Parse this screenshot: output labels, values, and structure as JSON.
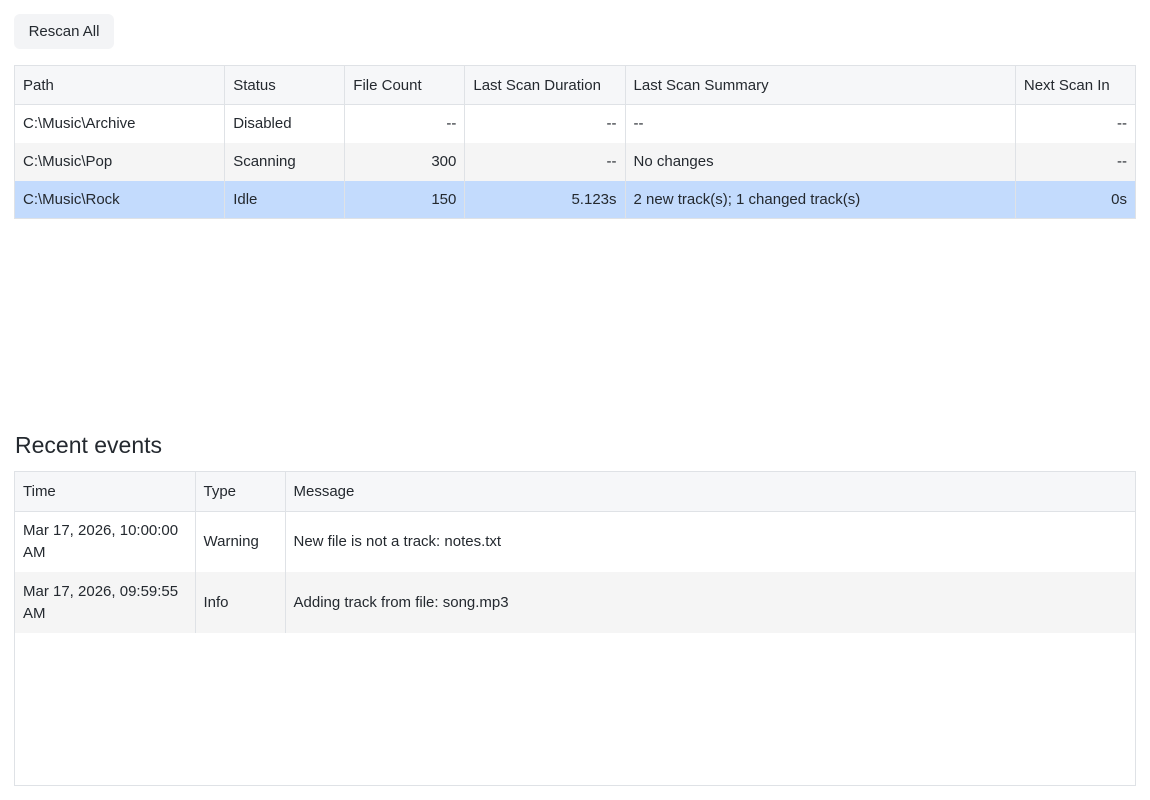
{
  "toolbar": {
    "rescan_label": "Rescan All"
  },
  "libraries": {
    "columns": [
      "Path",
      "Status",
      "File Count",
      "Last Scan Duration",
      "Last Scan Summary",
      "Next Scan In"
    ],
    "rows": [
      {
        "path": "C:\\Music\\Archive",
        "status": "Disabled",
        "file_count": "--",
        "duration": "--",
        "summary": "--",
        "next_scan": "--",
        "selected": false
      },
      {
        "path": "C:\\Music\\Pop",
        "status": "Scanning",
        "file_count": "300",
        "duration": "--",
        "summary": "No changes",
        "next_scan": "--",
        "selected": false
      },
      {
        "path": "C:\\Music\\Rock",
        "status": "Idle",
        "file_count": "150",
        "duration": "5.123s",
        "summary": "2 new track(s); 1 changed track(s)",
        "next_scan": "0s",
        "selected": true
      }
    ]
  },
  "events": {
    "heading": "Recent events",
    "columns": [
      "Time",
      "Type",
      "Message"
    ],
    "rows": [
      {
        "time": "Mar 17, 2026, 10:00:00 AM",
        "type": "Warning",
        "message": "New file is not a track: notes.txt"
      },
      {
        "time": "Mar 17, 2026, 09:59:55 AM",
        "type": "Info",
        "message": "Adding track from file: song.mp3"
      }
    ]
  },
  "colors": {
    "selected_row": "#c3dbfd",
    "header_bg": "#f6f7f9",
    "border": "#dfe2e6",
    "button_bg": "#f3f4f6"
  }
}
